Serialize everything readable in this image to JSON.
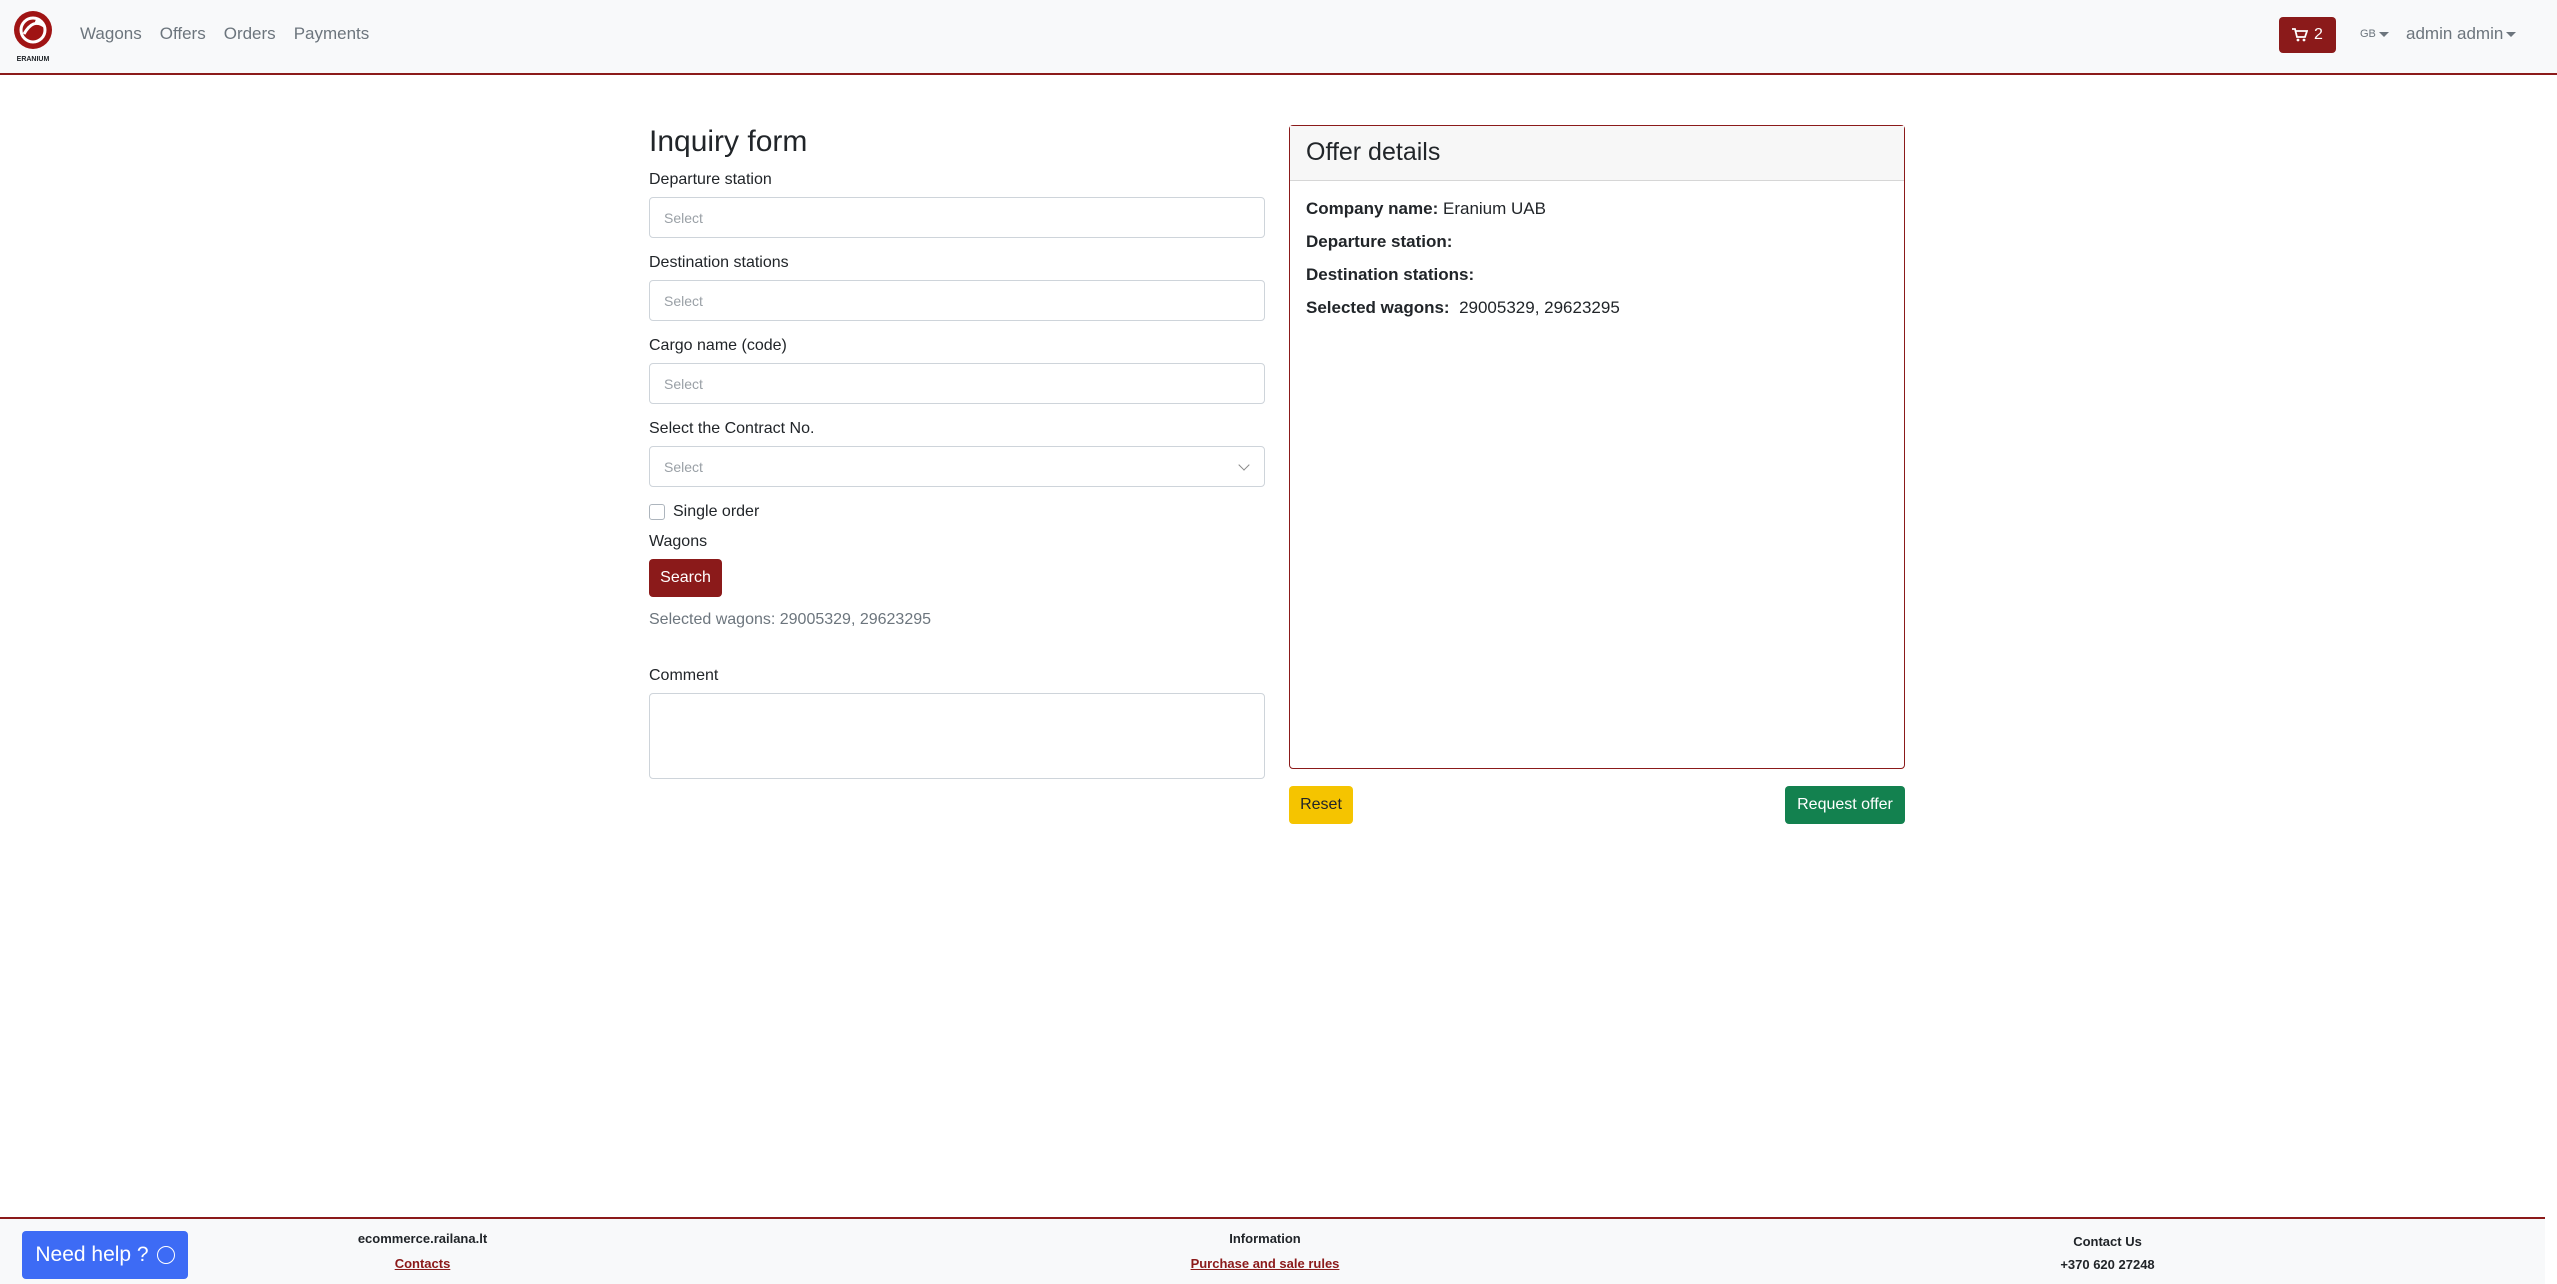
{
  "nav": {
    "brand": "ERANIUM",
    "links": [
      "Wagons",
      "Offers",
      "Orders",
      "Payments"
    ],
    "cart_count": "2",
    "language": "GB",
    "user": "admin admin"
  },
  "form": {
    "title": "Inquiry form",
    "departure_label": "Departure station",
    "departure_placeholder": "Select",
    "destination_label": "Destination stations",
    "destination_placeholder": "Select",
    "cargo_label": "Cargo name (code)",
    "cargo_placeholder": "Select",
    "contract_label": "Select the Contract No.",
    "contract_placeholder": "Select",
    "single_order_label": "Single order",
    "wagons_label": "Wagons",
    "search_label": "Search",
    "selected_wagons_text": "Selected wagons: 29005329, 29623295",
    "comment_label": "Comment"
  },
  "offer": {
    "title": "Offer details",
    "company_label": "Company name:",
    "company_value": "Eranium UAB",
    "departure_label": "Departure station:",
    "destination_label": "Destination stations:",
    "wagons_label": "Selected wagons:",
    "wagons_value": "29005329, 29623295"
  },
  "actions": {
    "reset": "Reset",
    "request": "Request offer"
  },
  "footer": {
    "site": "ecommerce.railana.lt",
    "contacts": "Contacts",
    "info_title": "Information",
    "rules": "Purchase and sale rules",
    "contact_title": "Contact Us",
    "phone": "+370 620 27248",
    "help": "Need help ?"
  },
  "colors": {
    "brand": "#8b1a1a",
    "reset": "#f5c400",
    "request": "#13814f",
    "help": "#3d6bf5"
  }
}
